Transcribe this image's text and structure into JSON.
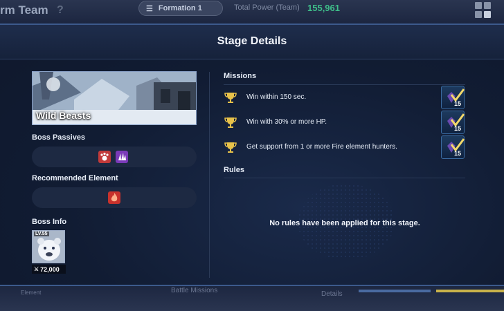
{
  "background": {
    "title": "rm Team",
    "help": "?",
    "formation_label": "Formation 1",
    "total_power_label": "Total Power (Team)",
    "total_power_value": "155,961",
    "bottom_element": "Element",
    "bottom_missions": "Battle Missions",
    "bottom_details": "Details"
  },
  "modal": {
    "title": "Stage Details",
    "stage_name": "Wild Beasts",
    "boss_passives_label": "Boss Passives",
    "recommended_element_label": "Recommended Element",
    "boss_info_label": "Boss Info",
    "boss": {
      "level": "LV.55",
      "power": "72,000"
    },
    "missions_label": "Missions",
    "missions": [
      {
        "text": "Win within 150 sec.",
        "reward_count": "15"
      },
      {
        "text": "Win with 30% or more HP.",
        "reward_count": "15"
      },
      {
        "text": "Get support from 1 or more Fire element hunters.",
        "reward_count": "15"
      }
    ],
    "rules_label": "Rules",
    "rules_empty": "No rules have been applied for this stage."
  },
  "colors": {
    "modal_bg": "#111c33",
    "accent_line": "#3c5a8c",
    "trophy": "#e8c24a",
    "fire": "#c8322c",
    "passive_beast": "#c13a3a",
    "passive_magic": "#7a3ab8",
    "power_green": "#3fbf8a"
  },
  "icons": {
    "passive_1": "paw-icon",
    "passive_2": "claw-icon",
    "element": "fire-icon",
    "mission": "trophy-icon",
    "reward": "crystal-check-icon"
  }
}
